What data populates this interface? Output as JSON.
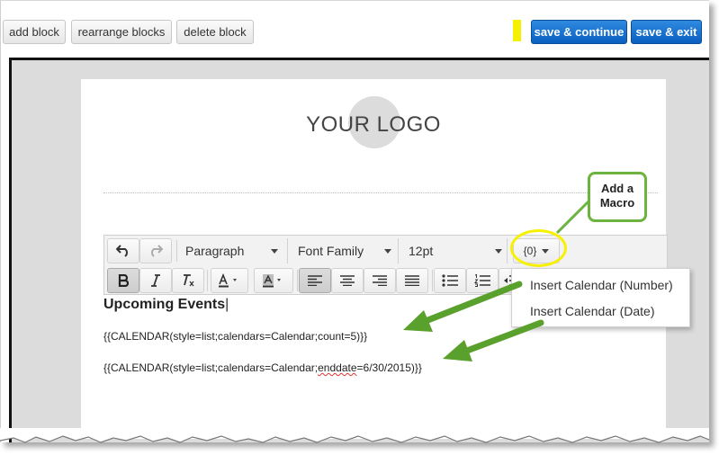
{
  "top_toolbar": {
    "add_block": "add block",
    "rearrange_blocks": "rearrange blocks",
    "delete_block": "delete block",
    "save_continue": "save & continue",
    "save_exit": "save & exit"
  },
  "logo": {
    "text": "YOUR LOGO"
  },
  "editor_toolbar": {
    "paragraph": "Paragraph",
    "font_family": "Font Family",
    "font_size": "12pt",
    "macro": "{0}"
  },
  "macro_menu": {
    "items": [
      "Insert Calendar (Number)",
      "Insert Calendar (Date)"
    ]
  },
  "callout": {
    "line1": "Add a",
    "line2": "Macro"
  },
  "content": {
    "heading": "Upcoming Events",
    "line1": "{{CALENDAR(style=list;calendars=Calendar;count=5)}}",
    "line2_pre": "{{CALENDAR(style=list;calendars=Calendar;",
    "line2_mid": "enddate",
    "line2_post": "=6/30/2015)}}"
  },
  "colors": {
    "primary_button": "#0a5fbf",
    "highlight": "#f7f000",
    "arrow_green": "#5aa02c"
  }
}
